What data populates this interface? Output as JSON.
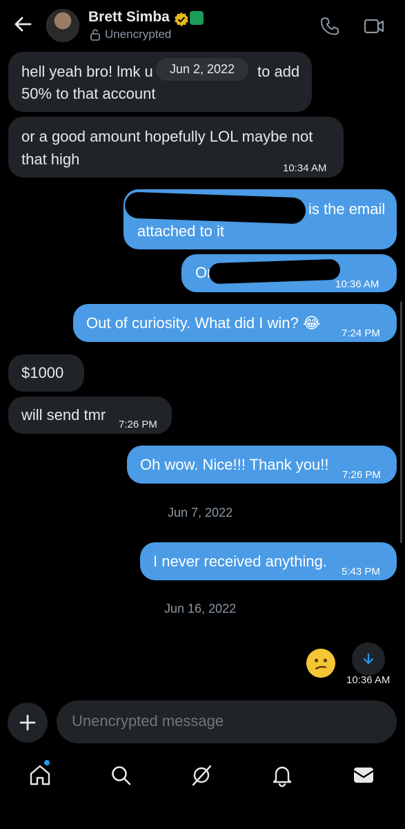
{
  "header": {
    "name": "Brett Simba",
    "status": "Unencrypted"
  },
  "date_pill": "Jun 2, 2022",
  "messages": [
    {
      "line1": "hell yeah bro! lmk u",
      "line1b": "to add",
      "line2": "50% to that account"
    },
    {
      "line1": "or a good amount hopefully LOL maybe not",
      "line2": "that high",
      "time": "10:34 AM"
    },
    {
      "line1_visible": "is the email",
      "line2": "attached to it"
    },
    {
      "text_visible": "Or (",
      "time": "10:36 AM"
    },
    {
      "text": "Out of curiosity. What did I win? 😂",
      "time": "7:24 PM"
    },
    {
      "text": "$1000"
    },
    {
      "text": "will send tmr",
      "time": "7:26 PM"
    },
    {
      "text": "Oh wow. Nice!!! Thank you!!",
      "time": "7:26 PM"
    },
    {
      "text": "I never received anything.",
      "time": "5:43 PM"
    }
  ],
  "dividers": [
    "Jun 7, 2022",
    "Jun 16, 2022"
  ],
  "last_message": {
    "time": "10:36 AM"
  },
  "composer": {
    "placeholder": "Unencrypted message"
  },
  "icons": {
    "back": "arrow-left-icon",
    "phone": "phone-icon",
    "video": "video-icon",
    "lock": "lock-icon",
    "verified": "verified-badge-icon",
    "emoji": "confused-face-icon",
    "scroll_down": "arrow-down-icon",
    "plus": "plus-icon",
    "nav": [
      "home-icon",
      "search-icon",
      "grok-icon",
      "bell-icon",
      "mail-icon"
    ]
  },
  "colors": {
    "outgoing": "#4b9be6",
    "incoming": "#202327",
    "accent": "#1d9bf0"
  }
}
